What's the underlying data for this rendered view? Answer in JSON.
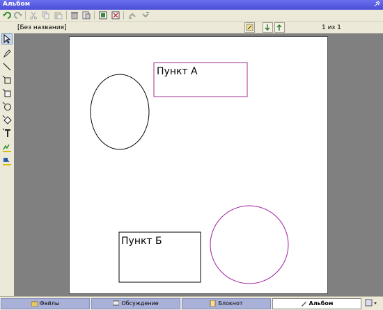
{
  "window": {
    "title": "Альбом"
  },
  "toolbar": {
    "icons": [
      "undo-icon",
      "redo-icon",
      "cut-icon",
      "copy-icon",
      "paste-icon",
      "delete-icon",
      "clear-icon",
      "image-insert-icon",
      "image-remove-icon",
      "layer-up-icon",
      "layer-down-icon"
    ]
  },
  "document": {
    "name": "[Без названия]",
    "page_info": "1 из 1"
  },
  "tools": [
    "select-tool-icon",
    "pencil-tool-icon",
    "line-tool-icon",
    "rectangle-tool-icon",
    "filled-rectangle-tool-icon",
    "ellipse-tool-icon",
    "filled-ellipse-tool-icon",
    "text-tool-icon",
    "line-color-icon",
    "fill-color-icon"
  ],
  "canvas": {
    "label_a": "Пункт А",
    "label_b": "Пункт Б",
    "colors": {
      "rect_a": "#a0308a",
      "rect_b": "#000000",
      "ellipse_left": "#000000",
      "circle_right": "#a020a0"
    }
  },
  "tabs": [
    {
      "label": "Файлы",
      "icon": "folder-icon"
    },
    {
      "label": "Обсуждение",
      "icon": "chat-icon"
    },
    {
      "label": "Блокнот",
      "icon": "notepad-icon"
    },
    {
      "label": "Альбом",
      "icon": "album-icon",
      "active": true
    }
  ]
}
